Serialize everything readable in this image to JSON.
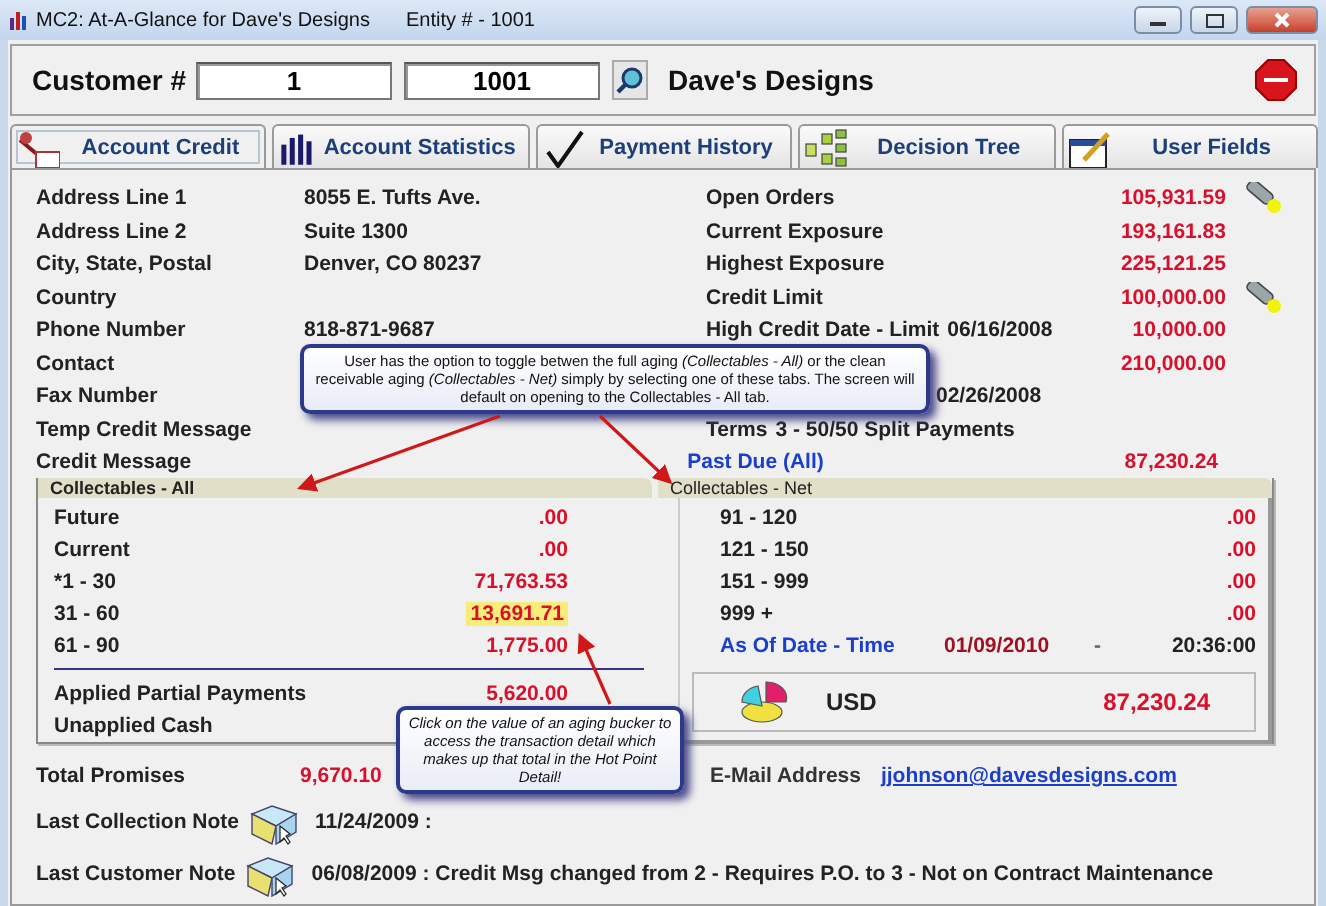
{
  "window": {
    "title": "MC2: At-A-Glance for Dave's Designs",
    "entity": "Entity # - 1001"
  },
  "customer": {
    "label": "Customer #",
    "field_1": "1",
    "field_2": "1001",
    "name": "Dave's Designs"
  },
  "tabs": [
    {
      "label": "Account Credit",
      "kind": "credit",
      "selected": true
    },
    {
      "label": "Account Statistics",
      "kind": "stats",
      "selected": false
    },
    {
      "label": "Payment History",
      "kind": "check",
      "selected": false
    },
    {
      "label": "Decision Tree",
      "kind": "tree",
      "selected": false
    },
    {
      "label": "User Fields",
      "kind": "fields",
      "selected": false
    }
  ],
  "info_left": [
    {
      "label": "Address Line 1",
      "value": "8055 E. Tufts Ave."
    },
    {
      "label": "Address Line 2",
      "value": "Suite 1300"
    },
    {
      "label": "City, State, Postal",
      "value": "Denver, CO   80237"
    },
    {
      "label": "Country"
    },
    {
      "label": "Phone Number",
      "value": "818-871-9687"
    },
    {
      "label": "Contact"
    },
    {
      "label": "Fax Number"
    },
    {
      "label": "Temp Credit Message"
    }
  ],
  "info_right": [
    {
      "kind": "labeled",
      "label": "Open Orders",
      "amount": "105,931.59",
      "flashlight": true
    },
    {
      "kind": "labeled",
      "label": "Current Exposure",
      "amount": "193,161.83",
      "flashlight": false
    },
    {
      "kind": "labeled",
      "label": "Highest Exposure",
      "amount": "225,121.25",
      "flashlight": false
    },
    {
      "kind": "labeled",
      "label": "Credit Limit",
      "amount": "100,000.00",
      "flashlight": true
    },
    {
      "kind": "labeled",
      "label": "High Credit Date - Limit",
      "text": "06/16/2008",
      "amount": "10,000.00",
      "flashlight": false
    },
    {
      "kind": "labeled",
      "amount": "210,000.00",
      "flashlight": false
    },
    {
      "kind": "date_only",
      "text": "02/26/2008",
      "flashlight": false
    },
    {
      "kind": "labeled",
      "label": "Terms",
      "text": "3  - 50/50 Split Payments",
      "flashlight": false
    }
  ],
  "credit_message": {
    "label": "Credit Message"
  },
  "past_due": {
    "label": "Past Due (All)",
    "amount": "87,230.24"
  },
  "aging": {
    "tabs": [
      {
        "label": "Collectables - All",
        "selected": true
      },
      {
        "label": "Collectables - Net",
        "selected": false
      }
    ],
    "left": [
      {
        "label": "Future",
        "amount": ".00",
        "highlighted": false
      },
      {
        "label": "Current",
        "amount": ".00",
        "highlighted": false
      },
      {
        "label": "*1 - 30",
        "amount": "71,763.53",
        "highlighted": false
      },
      {
        "label": "31 - 60",
        "amount": "13,691.71",
        "highlighted": true
      },
      {
        "label": "61 - 90",
        "amount": "1,775.00",
        "highlighted": false
      }
    ],
    "summary": [
      {
        "label": "Applied Partial Payments",
        "amount": "5,620.00"
      },
      {
        "label": "Unapplied Cash"
      }
    ],
    "right": [
      {
        "label": "91 - 120",
        "amount": ".00"
      },
      {
        "label": "121 - 150",
        "amount": ".00"
      },
      {
        "label": "151 - 999",
        "amount": ".00"
      },
      {
        "label": "999 +",
        "amount": ".00"
      }
    ],
    "as_of": {
      "label": "As Of Date - Time",
      "date": "01/09/2010",
      "separator": "-",
      "time": "20:36:00"
    },
    "total": {
      "currency": "USD",
      "amount": "87,230.24"
    }
  },
  "total_promises": {
    "label": "Total Promises",
    "amount": "9,670.10"
  },
  "email": {
    "label": "E-Mail Address",
    "value": "jjohnson@davesdesigns.com"
  },
  "notes": [
    {
      "label": "Last Collection Note",
      "text": "11/24/2009 :"
    },
    {
      "label": "Last Customer Note",
      "text": "06/08/2009 : Credit Msg changed from 2  - Requires P.O. to 3  - Not on Contract Maintenance"
    }
  ],
  "callouts": [
    {
      "text": "User has the option to toggle betwen the full aging *(Collectables - All)* or the clean receivable aging *(Collectables - Net)* simply by selecting one of these tabs.  The screen will default on opening to the Collectables - All tab."
    },
    {
      "text": "Click on the value of an aging bucker to access the transaction detail which makes up that total in the Hot Point Detail!"
    }
  ]
}
